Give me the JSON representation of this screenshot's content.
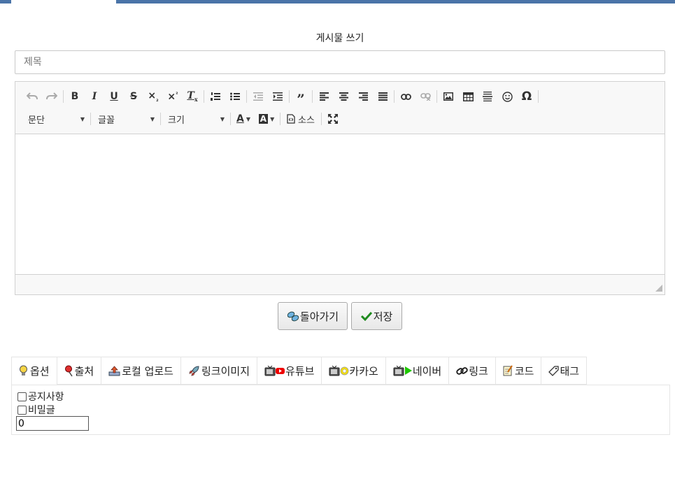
{
  "page_title": "게시물 쓰기",
  "title_input": {
    "placeholder": "제목",
    "value": ""
  },
  "toolbar": {
    "format_combo": "문단",
    "font_combo": "글꼴",
    "size_combo": "크기",
    "source_label": "소스"
  },
  "buttons": {
    "back": "돌아가기",
    "save": "저장"
  },
  "tabs": [
    {
      "label": "옵션",
      "icon": "lightbulb-icon"
    },
    {
      "label": "출처",
      "icon": "pin-icon"
    },
    {
      "label": "로컬 업로드",
      "icon": "upload-icon"
    },
    {
      "label": "링크이미지",
      "icon": "rocket-icon"
    },
    {
      "label": "유튜브",
      "icon": "youtube-icon"
    },
    {
      "label": "카카오",
      "icon": "kakao-icon"
    },
    {
      "label": "네이버",
      "icon": "naver-icon"
    },
    {
      "label": "링크",
      "icon": "link-icon"
    },
    {
      "label": "코드",
      "icon": "memo-icon"
    },
    {
      "label": "태그",
      "icon": "tag-icon"
    }
  ],
  "options": {
    "notice_label": "공지사항",
    "secret_label": "비밀글",
    "number_value": "0"
  },
  "colors": {
    "accent_bar": "#4a74a8"
  }
}
